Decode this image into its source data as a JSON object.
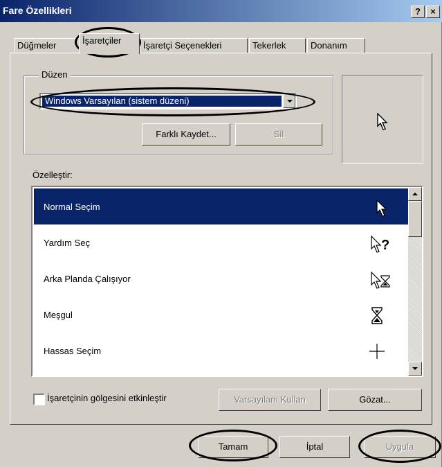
{
  "window": {
    "title": "Fare Özellikleri",
    "help_btn": "?",
    "close_btn": "×"
  },
  "tabs": [
    "Düğmeler",
    "İşaretçiler",
    "İşaretçi Seçenekleri",
    "Tekerlek",
    "Donanım"
  ],
  "scheme": {
    "label": "Düzen",
    "selected": "Windows Varsayılan (sistem düzeni)",
    "save_as_label": "Farklı Kaydet...",
    "delete_label": "Sil"
  },
  "customize": {
    "label": "Özelleştir:",
    "items": [
      {
        "label": "Normal Seçim",
        "icon": "arrow-cursor-icon"
      },
      {
        "label": "Yardım Seç",
        "icon": "help-cursor-icon"
      },
      {
        "label": "Arka Planda Çalışıyor",
        "icon": "busy-background-cursor-icon"
      },
      {
        "label": "Meşgul",
        "icon": "hourglass-cursor-icon"
      },
      {
        "label": "Hassas Seçim",
        "icon": "crosshair-cursor-icon"
      }
    ]
  },
  "shadow_option": {
    "label": "İşaretçinin gölgesini etkinleştir",
    "checked": false
  },
  "buttons": {
    "use_default": "Varsayılanı Kullan",
    "browse": "Gözat...",
    "ok": "Tamam",
    "cancel": "İptal",
    "apply": "Uygula"
  }
}
